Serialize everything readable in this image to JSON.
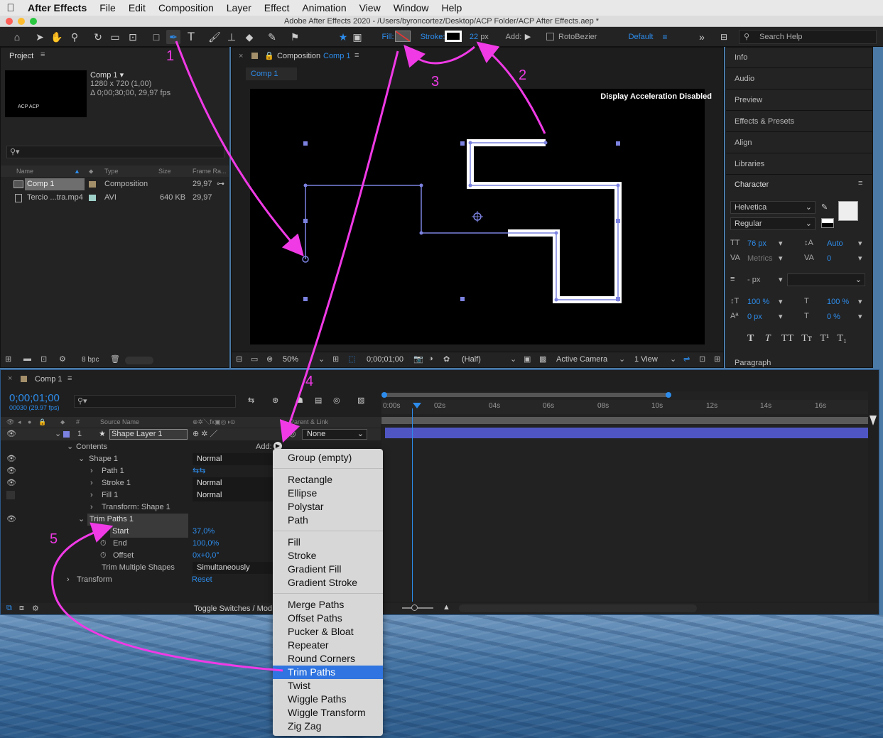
{
  "menubar": {
    "app": "After Effects",
    "items": [
      "File",
      "Edit",
      "Composition",
      "Layer",
      "Effect",
      "Animation",
      "View",
      "Window",
      "Help"
    ]
  },
  "window": {
    "title": "Adobe After Effects 2020 - /Users/byroncortez/Desktop/ACP Folder/ACP After Effects.aep *"
  },
  "toolbar": {
    "fill_label": "Fill:",
    "stroke_label": "Stroke:",
    "stroke_width": "22",
    "stroke_unit": "px",
    "add_label": "Add:",
    "rotobezier_label": "RotoBezier",
    "workspace": "Default",
    "search_placeholder": "Search Help"
  },
  "project": {
    "title": "Project",
    "comp_name": "Comp 1 ▾",
    "comp_info1": "1280 x 720 (1,00)",
    "comp_info2": "Δ 0;00;30;00, 29,97 fps",
    "thumb_text": "ACP ACP",
    "bpc": "8 bpc",
    "columns": {
      "name": "Name",
      "type": "Type",
      "size": "Size",
      "frame_rate": "Frame Ra..."
    },
    "items": [
      {
        "name": "Comp 1",
        "type": "Composition",
        "size": "",
        "frame_rate": "29,97"
      },
      {
        "name": "Tercio ...tra.mp4",
        "type": "AVI",
        "size": "640 KB",
        "frame_rate": "29,97"
      }
    ]
  },
  "composition": {
    "tab_prefix": "Composition",
    "tab_name": "Comp 1",
    "subtab": "Comp 1",
    "notice": "Display Acceleration Disabled",
    "footer": {
      "zoom": "50%",
      "timecode": "0;00;01;00",
      "resolution": "(Half)",
      "camera": "Active Camera",
      "views": "1 View"
    }
  },
  "right_panels": {
    "items": [
      "Info",
      "Audio",
      "Preview",
      "Effects & Presets",
      "Align",
      "Libraries"
    ],
    "paragraph": "Paragraph"
  },
  "character": {
    "title": "Character",
    "font": "Helvetica",
    "style": "Regular",
    "font_size": "76 px",
    "leading": "Auto",
    "kerning": "Metrics",
    "tracking": "0",
    "stroke_width": "- px",
    "vscale": "100 %",
    "hscale": "100 %",
    "baseline": "0 px",
    "tsume": "0 %",
    "styles": [
      "T",
      "T",
      "TT",
      "Tт",
      "T¹",
      "T₁"
    ]
  },
  "timeline": {
    "tab": "Comp 1",
    "timecode": "0;00;01;00",
    "fps_info": "00030 (29.97 fps)",
    "columns": {
      "num": "#",
      "source": "Source Name",
      "parent": "Parent & Link"
    },
    "layer": {
      "num": "1",
      "name": "Shape Layer 1",
      "parent": "None"
    },
    "contents": "Contents",
    "add_label": "Add:",
    "shape": "Shape 1",
    "shape_mode": "Normal",
    "path": "Path 1",
    "stroke": "Stroke 1",
    "stroke_mode": "Normal",
    "fill": "Fill 1",
    "fill_mode": "Normal",
    "transform_shape": "Transform: Shape 1",
    "trim": "Trim Paths 1",
    "start_label": "Start",
    "start_value": "37,0%",
    "end_label": "End",
    "end_value": "100,0%",
    "offset_label": "Offset",
    "offset_value": "0x+0,0°",
    "trim_multiple_label": "Trim Multiple Shapes",
    "trim_multiple_value": "Simultaneously",
    "transform": "Transform",
    "reset": "Reset",
    "toggle": "Toggle Switches / Mod",
    "ruler": [
      "0:00s",
      "02s",
      "04s",
      "06s",
      "08s",
      "10s",
      "12s",
      "14s",
      "16s"
    ]
  },
  "add_menu": {
    "items": [
      "Group (empty)",
      "Rectangle",
      "Ellipse",
      "Polystar",
      "Path",
      "Fill",
      "Stroke",
      "Gradient Fill",
      "Gradient Stroke",
      "Merge Paths",
      "Offset Paths",
      "Pucker & Bloat",
      "Repeater",
      "Round Corners",
      "Trim Paths",
      "Twist",
      "Wiggle Paths",
      "Wiggle Transform",
      "Zig Zag"
    ],
    "selected": "Trim Paths"
  },
  "annotations": {
    "n1": "1",
    "n2": "2",
    "n3": "3",
    "n4": "4",
    "n5": "5",
    "color": "#f03ae6"
  },
  "colors": {
    "accent": "#2d8ceb",
    "menu_highlight": "#2f74e0",
    "layer_bar": "#4f56c4",
    "path": "#7c82e0"
  }
}
